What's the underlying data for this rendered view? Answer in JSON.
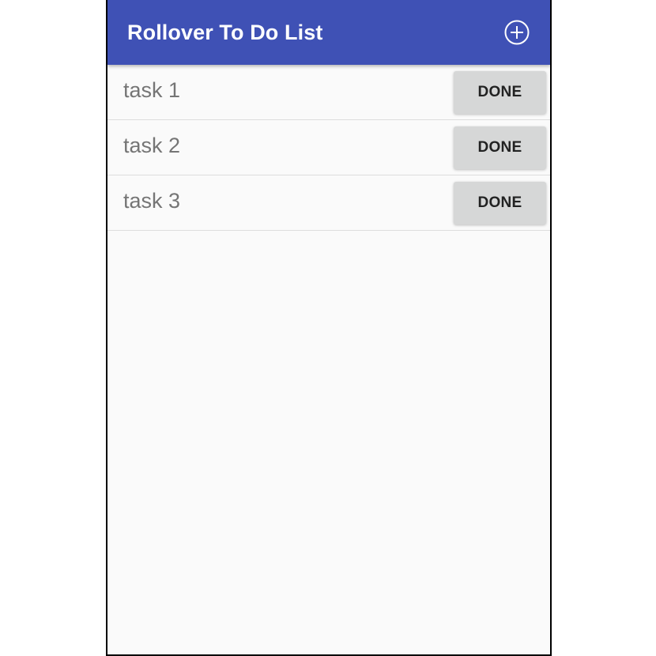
{
  "app_bar": {
    "title": "Rollover To Do List",
    "add_icon": "add-circle-icon",
    "color": "#3f51b5"
  },
  "tasks": [
    {
      "name": "task 1",
      "action_label": "DONE"
    },
    {
      "name": "task 2",
      "action_label": "DONE"
    },
    {
      "name": "task 3",
      "action_label": "DONE"
    }
  ]
}
